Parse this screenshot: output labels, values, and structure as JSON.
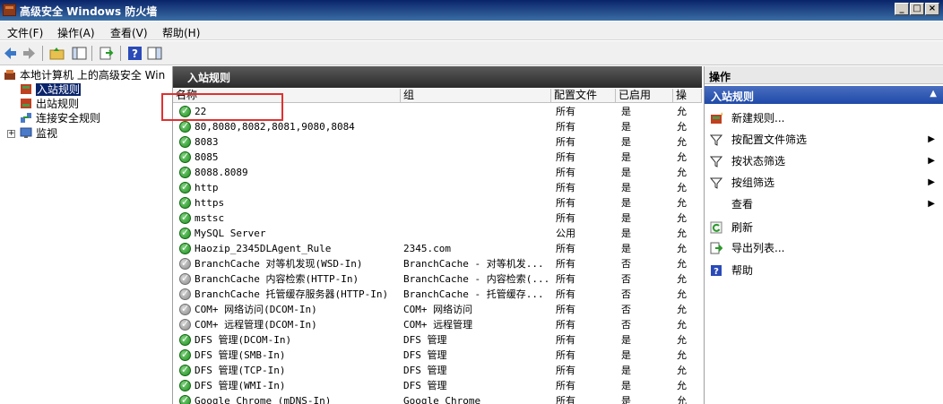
{
  "window": {
    "title": "高级安全 Windows 防火墙",
    "min": "_",
    "max": "□",
    "close": "×"
  },
  "menu": [
    "文件(F)",
    "操作(A)",
    "查看(V)",
    "帮助(H)"
  ],
  "tree": {
    "root": "本地计算机 上的高级安全 Win",
    "items": [
      "入站规则",
      "出站规则",
      "连接安全规则",
      "监视"
    ]
  },
  "center": {
    "title": "入站规则",
    "columns": [
      "名称",
      "组",
      "配置文件",
      "已启用",
      "操"
    ],
    "rows": [
      {
        "name": "22",
        "group": "",
        "profile": "所有",
        "enabled": "是",
        "action": "允",
        "state": "enabled"
      },
      {
        "name": "80,8080,8082,8081,9080,8084",
        "group": "",
        "profile": "所有",
        "enabled": "是",
        "action": "允",
        "state": "enabled"
      },
      {
        "name": "8083",
        "group": "",
        "profile": "所有",
        "enabled": "是",
        "action": "允",
        "state": "enabled"
      },
      {
        "name": "8085",
        "group": "",
        "profile": "所有",
        "enabled": "是",
        "action": "允",
        "state": "enabled"
      },
      {
        "name": "8088.8089",
        "group": "",
        "profile": "所有",
        "enabled": "是",
        "action": "允",
        "state": "enabled"
      },
      {
        "name": "http",
        "group": "",
        "profile": "所有",
        "enabled": "是",
        "action": "允",
        "state": "enabled"
      },
      {
        "name": "https",
        "group": "",
        "profile": "所有",
        "enabled": "是",
        "action": "允",
        "state": "enabled"
      },
      {
        "name": "mstsc",
        "group": "",
        "profile": "所有",
        "enabled": "是",
        "action": "允",
        "state": "enabled"
      },
      {
        "name": "MySQL Server",
        "group": "",
        "profile": "公用",
        "enabled": "是",
        "action": "允",
        "state": "enabled"
      },
      {
        "name": "Haozip_2345DLAgent_Rule",
        "group": "2345.com",
        "profile": "所有",
        "enabled": "是",
        "action": "允",
        "state": "enabled"
      },
      {
        "name": "BranchCache 对等机发现(WSD-In)",
        "group": "BranchCache - 对等机发...",
        "profile": "所有",
        "enabled": "否",
        "action": "允",
        "state": "disabled"
      },
      {
        "name": "BranchCache 内容检索(HTTP-In)",
        "group": "BranchCache - 内容检索(...",
        "profile": "所有",
        "enabled": "否",
        "action": "允",
        "state": "disabled"
      },
      {
        "name": "BranchCache 托管缓存服务器(HTTP-In)",
        "group": "BranchCache - 托管缓存...",
        "profile": "所有",
        "enabled": "否",
        "action": "允",
        "state": "disabled"
      },
      {
        "name": "COM+ 网络访问(DCOM-In)",
        "group": "COM+ 网络访问",
        "profile": "所有",
        "enabled": "否",
        "action": "允",
        "state": "disabled"
      },
      {
        "name": "COM+ 远程管理(DCOM-In)",
        "group": "COM+ 远程管理",
        "profile": "所有",
        "enabled": "否",
        "action": "允",
        "state": "disabled"
      },
      {
        "name": "DFS 管理(DCOM-In)",
        "group": "DFS 管理",
        "profile": "所有",
        "enabled": "是",
        "action": "允",
        "state": "enabled"
      },
      {
        "name": "DFS 管理(SMB-In)",
        "group": "DFS 管理",
        "profile": "所有",
        "enabled": "是",
        "action": "允",
        "state": "enabled"
      },
      {
        "name": "DFS 管理(TCP-In)",
        "group": "DFS 管理",
        "profile": "所有",
        "enabled": "是",
        "action": "允",
        "state": "enabled"
      },
      {
        "name": "DFS 管理(WMI-In)",
        "group": "DFS 管理",
        "profile": "所有",
        "enabled": "是",
        "action": "允",
        "state": "enabled"
      },
      {
        "name": "Google Chrome (mDNS-In)",
        "group": "Google Chrome",
        "profile": "所有",
        "enabled": "是",
        "action": "允",
        "state": "enabled"
      }
    ]
  },
  "actions": {
    "title": "操作",
    "section": "入站规则",
    "section_arrow": "▲",
    "items": [
      {
        "label": "新建规则...",
        "icon": "new-rule-icon",
        "arrow": ""
      },
      {
        "label": "按配置文件筛选",
        "icon": "filter-icon",
        "arrow": "▶"
      },
      {
        "label": "按状态筛选",
        "icon": "filter-icon",
        "arrow": "▶"
      },
      {
        "label": "按组筛选",
        "icon": "filter-icon",
        "arrow": "▶"
      },
      {
        "label": "查看",
        "icon": "",
        "arrow": "▶"
      },
      {
        "label": "刷新",
        "icon": "refresh-icon",
        "arrow": ""
      },
      {
        "label": "导出列表...",
        "icon": "export-icon",
        "arrow": ""
      },
      {
        "label": "帮助",
        "icon": "help-icon",
        "arrow": ""
      }
    ]
  },
  "colors": {
    "enabled": "#1e8f1e",
    "disabled": "#8a8a8a",
    "highlight_box": "#e03030"
  }
}
